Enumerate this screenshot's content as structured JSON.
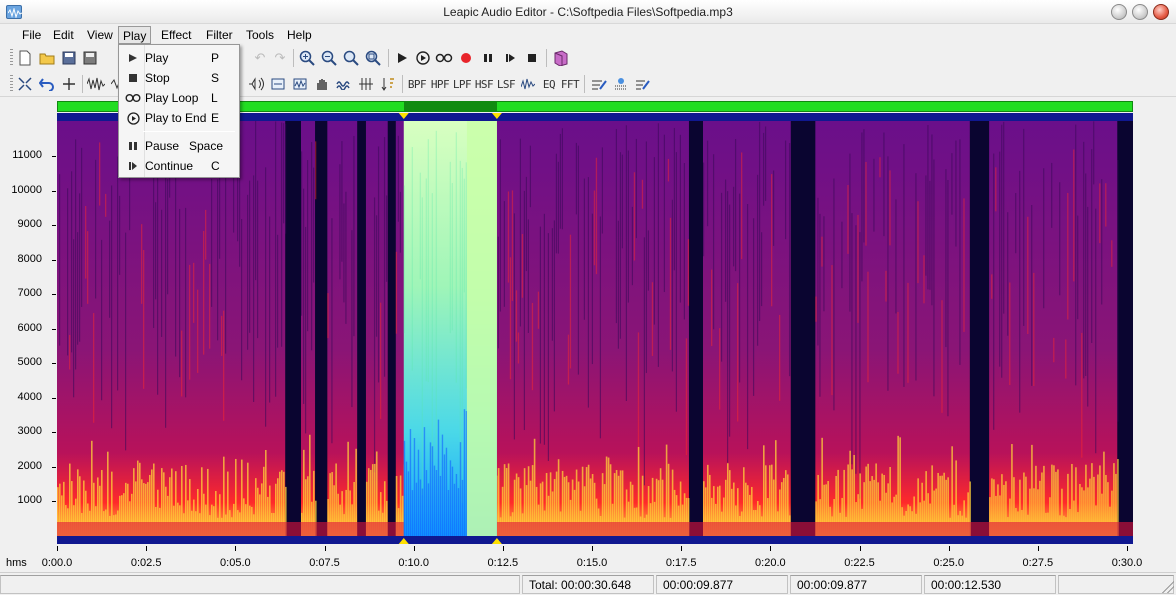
{
  "window": {
    "title": "Leapic Audio Editor - C:\\Softpedia Files\\Softpedia.mp3"
  },
  "menu": {
    "items": [
      "File",
      "Edit",
      "View",
      "Play",
      "Effect",
      "Filter",
      "Tools",
      "Help"
    ],
    "active": "Play"
  },
  "play_menu": {
    "items": [
      {
        "label": "Play",
        "shortcut": "P",
        "icon": "play-icon"
      },
      {
        "label": "Stop",
        "shortcut": "S",
        "icon": "stop-icon"
      },
      {
        "label": "Play Loop",
        "shortcut": "L",
        "icon": "loop-icon"
      },
      {
        "label": "Play to End",
        "shortcut": "E",
        "icon": "play-to-end-icon"
      },
      {
        "label": "Pause",
        "shortcut": "Space",
        "icon": "pause-icon"
      },
      {
        "label": "Continue",
        "shortcut": "C",
        "icon": "continue-icon"
      }
    ]
  },
  "toolbar2": {
    "filters": [
      "BPF",
      "HPF",
      "LPF",
      "HSF",
      "LSF",
      "EQ",
      "FFT"
    ]
  },
  "spectrogram": {
    "y_ticks": [
      "11000",
      "10000",
      "9000",
      "8000",
      "7000",
      "6000",
      "5000",
      "4000",
      "3000",
      "2000",
      "1000"
    ],
    "x_unit": "hms",
    "x_ticks": [
      "0:00.0",
      "0:02.5",
      "0:05.0",
      "0:07.5",
      "0:10.0",
      "0:12.5",
      "0:15.0",
      "0:17.5",
      "0:20.0",
      "0:22.5",
      "0:25.0",
      "0:27.5",
      "0:30.0"
    ],
    "total_seconds": 30.648,
    "selection_start_seconds": 9.877,
    "selection_end_seconds": 12.53,
    "silent_gaps_seconds": [
      [
        6.5,
        6.95
      ],
      [
        7.35,
        7.7
      ],
      [
        8.55,
        8.8
      ],
      [
        9.42,
        9.65
      ],
      [
        18.0,
        18.4
      ],
      [
        20.9,
        21.6
      ],
      [
        26.0,
        26.55
      ],
      [
        30.2,
        30.648
      ]
    ],
    "colors": {
      "background": "#0a0530",
      "base": "#6a0f8a",
      "hot": "#ff2a2a",
      "warm": "#ffd23a",
      "selection": "#c9ffa8"
    }
  },
  "status": {
    "total": "Total: 00:00:30.648",
    "cell1": "00:00:09.877",
    "cell2": "00:00:09.877",
    "cell3": "00:00:12.530"
  }
}
